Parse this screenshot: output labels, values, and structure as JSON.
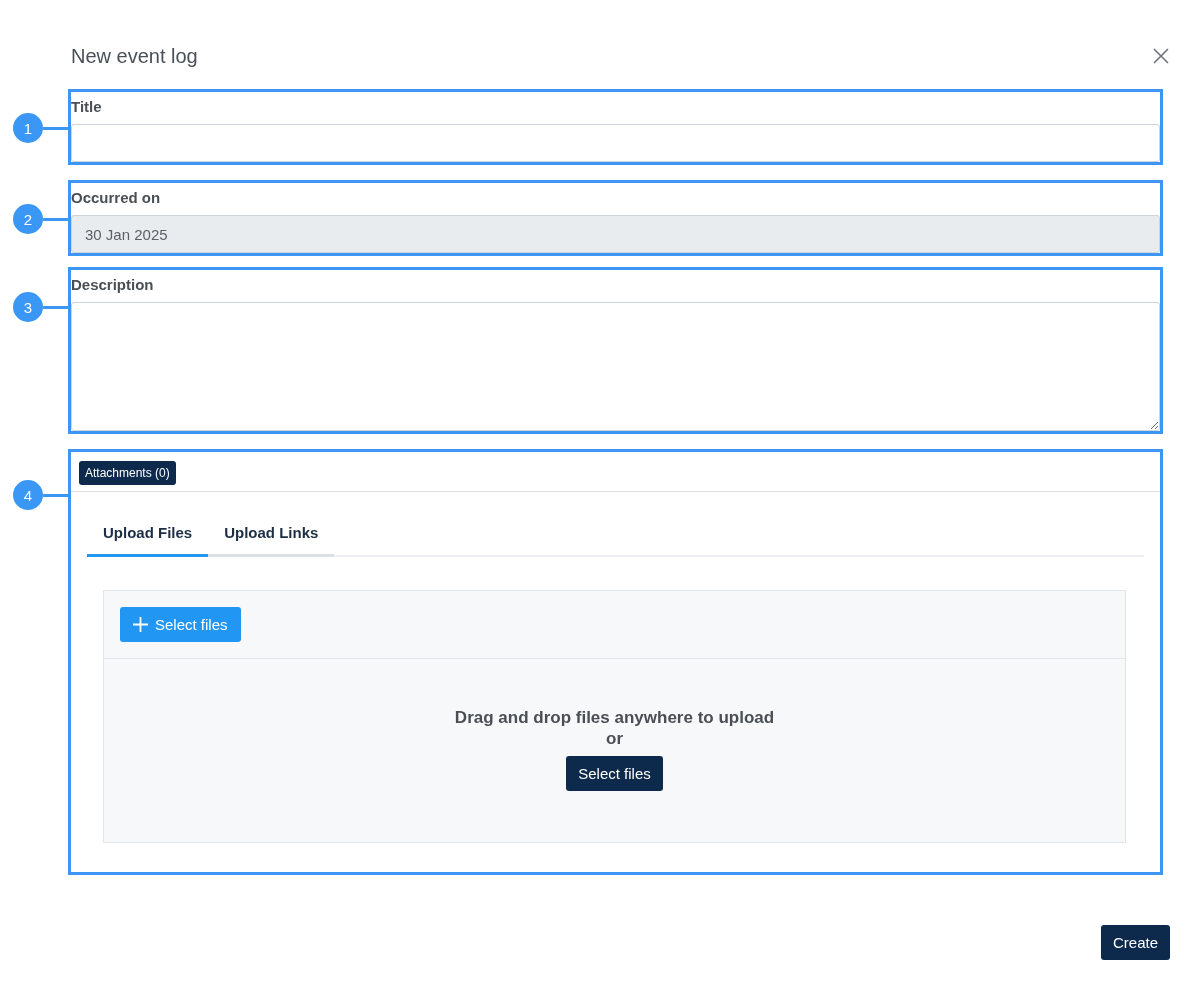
{
  "dialog": {
    "title": "New event log"
  },
  "fields": [
    {
      "callout": "1",
      "label": "Title",
      "kind": "text"
    },
    {
      "callout": "2",
      "label": "Occurred on",
      "kind": "date",
      "value": "30 Jan 2025",
      "disabled": true
    },
    {
      "callout": "3",
      "label": "Description",
      "kind": "textarea"
    }
  ],
  "attachments": {
    "callout": "4",
    "badge": "Attachments (0)",
    "tabs": [
      {
        "label": "Upload Files",
        "selected": true
      },
      {
        "label": "Upload Links",
        "selected": false
      }
    ],
    "select_button": "Select files",
    "drop_text": "Drag and drop files anywhere to upload",
    "or_text": "or",
    "drop_button": "Select files"
  },
  "footer": {
    "create_button": "Create"
  }
}
